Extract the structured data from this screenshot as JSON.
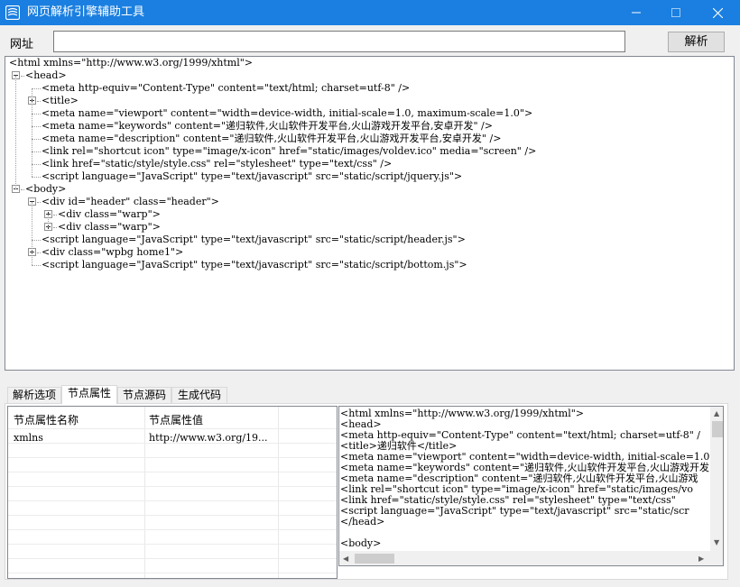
{
  "window": {
    "title": "网页解析引擎辅助工具",
    "colors": {
      "titlebar": "#1a7fe0",
      "selection": "#cce8ff"
    }
  },
  "toolbar": {
    "url_label": "网址",
    "url_value": "",
    "parse_label": "解析"
  },
  "tree": [
    {
      "text": "<html xmlns=\"http://www.w3.org/1999/xhtml\">",
      "toggle": "none"
    },
    {
      "text": "<head>",
      "toggle": "minus"
    },
    {
      "text": "<meta http-equiv=\"Content-Type\" content=\"text/html; charset=utf-8\" />",
      "toggle": "none"
    },
    {
      "text": "<title>",
      "toggle": "plus"
    },
    {
      "text": "<meta name=\"viewport\" content=\"width=device-width, initial-scale=1.0, maximum-scale=1.0\">",
      "toggle": "none"
    },
    {
      "text": "<meta name=\"keywords\" content=\"递归软件,火山软件开发平台,火山游戏开发平台,安卓开发\" />",
      "toggle": "none"
    },
    {
      "text": "<meta name=\"description\" content=\"递归软件,火山软件开发平台,火山游戏开发平台,安卓开发\" />",
      "toggle": "none"
    },
    {
      "text": "<link rel=\"shortcut icon\" type=\"image/x-icon\" href=\"static/images/voldev.ico\" media=\"screen\" />",
      "toggle": "none"
    },
    {
      "text": "<link href=\"static/style/style.css\" rel=\"stylesheet\" type=\"text/css\" />",
      "toggle": "none"
    },
    {
      "text": "<script language=\"JavaScript\" type=\"text/javascript\" src=\"static/script/jquery.js\">",
      "toggle": "none"
    },
    {
      "text": "<body>",
      "toggle": "minus"
    },
    {
      "text": "<div id=\"header\" class=\"header\">",
      "toggle": "minus"
    },
    {
      "text": "<div class=\"warp\">",
      "toggle": "plus"
    },
    {
      "text": "<div class=\"warp\">",
      "toggle": "plus"
    },
    {
      "text": "<script language=\"JavaScript\" type=\"text/javascript\" src=\"static/script/header.js\">",
      "toggle": "none"
    },
    {
      "text": "<div class=\"wpbg home1\">",
      "toggle": "plus"
    },
    {
      "text": "<script language=\"JavaScript\" type=\"text/javascript\" src=\"static/script/bottom.js\">",
      "toggle": "none"
    }
  ],
  "tabs": [
    {
      "label": "解析选项",
      "active": false
    },
    {
      "label": "节点属性",
      "active": true
    },
    {
      "label": "节点源码",
      "active": false
    },
    {
      "label": "生成代码",
      "active": false
    }
  ],
  "attributes": {
    "headers": [
      "节点属性名称",
      "节点属性值"
    ],
    "rows": [
      {
        "name": "xmlns",
        "value": "http://www.w3.org/19..."
      }
    ]
  },
  "source_lines": [
    "<html xmlns=\"http://www.w3.org/1999/xhtml\">",
    "<head>",
    "<meta http-equiv=\"Content-Type\" content=\"text/html; charset=utf-8\" /",
    "<title>递归软件</title>",
    "<meta name=\"viewport\" content=\"width=device-width, initial-scale=1.0",
    "<meta name=\"keywords\" content=\"递归软件,火山软件开发平台,火山游戏开发",
    "<meta name=\"description\" content=\"递归软件,火山软件开发平台,火山游戏",
    "<link rel=\"shortcut icon\" type=\"image/x-icon\" href=\"static/images/vo",
    "<link href=\"static/style/style.css\" rel=\"stylesheet\" type=\"text/css\"",
    "<script language=\"JavaScript\" type=\"text/javascript\" src=\"static/scr",
    "</head>",
    "",
    "<body>"
  ]
}
